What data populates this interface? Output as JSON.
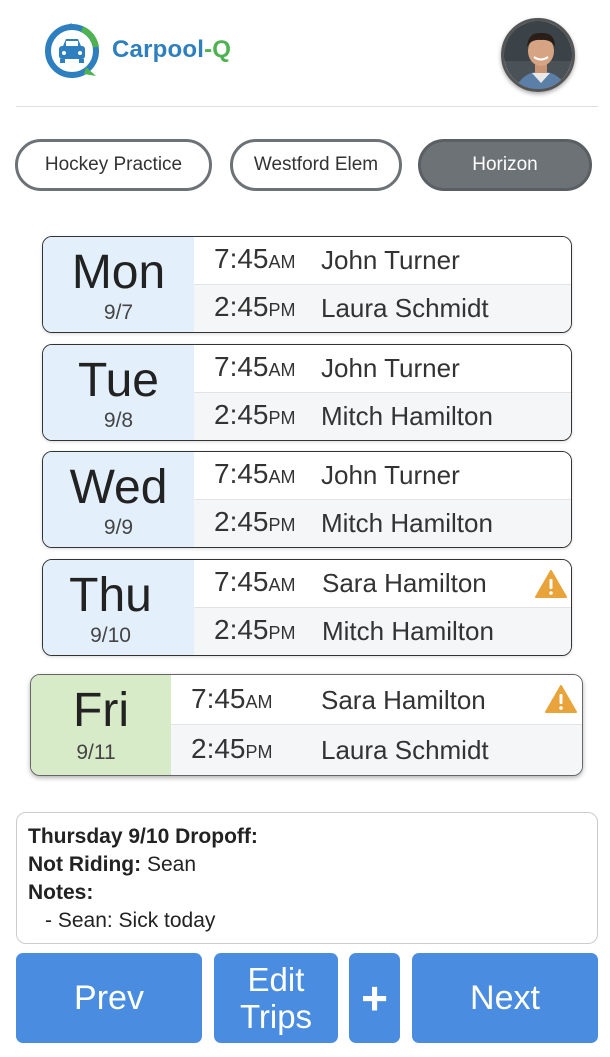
{
  "app": {
    "name_part1": "Carpool",
    "name_part2": "-Q",
    "logo_icon": "car-location-pin-icon",
    "avatar_icon": "user-avatar-photo",
    "brand_colors": {
      "blue": "#2e7fbf",
      "green": "#4db24f"
    }
  },
  "tabs": [
    {
      "label": "Hockey Practice",
      "active": false
    },
    {
      "label": "Westford Elem",
      "active": false
    },
    {
      "label": "Horizon",
      "active": true
    }
  ],
  "days": [
    {
      "day": "Mon",
      "date": "9/7",
      "trips": [
        {
          "time": "7:45",
          "ampm": "AM",
          "driver": "John Turner",
          "warning": false
        },
        {
          "time": "2:45",
          "ampm": "PM",
          "driver": "Laura Schmidt",
          "warning": false
        }
      ]
    },
    {
      "day": "Tue",
      "date": "9/8",
      "trips": [
        {
          "time": "7:45",
          "ampm": "AM",
          "driver": "John Turner",
          "warning": false
        },
        {
          "time": "2:45",
          "ampm": "PM",
          "driver": "Mitch Hamilton",
          "warning": false
        }
      ]
    },
    {
      "day": "Wed",
      "date": "9/9",
      "trips": [
        {
          "time": "7:45",
          "ampm": "AM",
          "driver": "John Turner",
          "warning": false
        },
        {
          "time": "2:45",
          "ampm": "PM",
          "driver": "Mitch Hamilton",
          "warning": false
        }
      ]
    },
    {
      "day": "Thu",
      "date": "9/10",
      "trips": [
        {
          "time": "7:45",
          "ampm": "AM",
          "driver": "Sara Hamilton",
          "warning": true
        },
        {
          "time": "2:45",
          "ampm": "PM",
          "driver": "Mitch Hamilton",
          "warning": false
        }
      ]
    },
    {
      "day": "Fri",
      "date": "9/11",
      "highlighted": true,
      "trips": [
        {
          "time": "7:45",
          "ampm": "AM",
          "driver": "Sara Hamilton",
          "warning": true
        },
        {
          "time": "2:45",
          "ampm": "PM",
          "driver": "Laura Schmidt",
          "warning": false
        }
      ]
    }
  ],
  "notes": {
    "title_day": "Thursday",
    "title_date": "9/10",
    "title_suffix": "Dropoff:",
    "not_riding_label": "Not Riding:",
    "not_riding_value": "Sean",
    "notes_label": "Notes:",
    "note_item": "- Sean: Sick today"
  },
  "buttons": {
    "prev": "Prev",
    "edit_line1": "Edit",
    "edit_line2": "Trips",
    "add": "+",
    "next": "Next"
  },
  "colors": {
    "primary_button": "#4a8ce0",
    "weekday_bg": "#e3f0fc",
    "highlight_day_bg": "#d8ebc8",
    "warning": "#e8a33a",
    "active_tab": "#6d7277"
  }
}
